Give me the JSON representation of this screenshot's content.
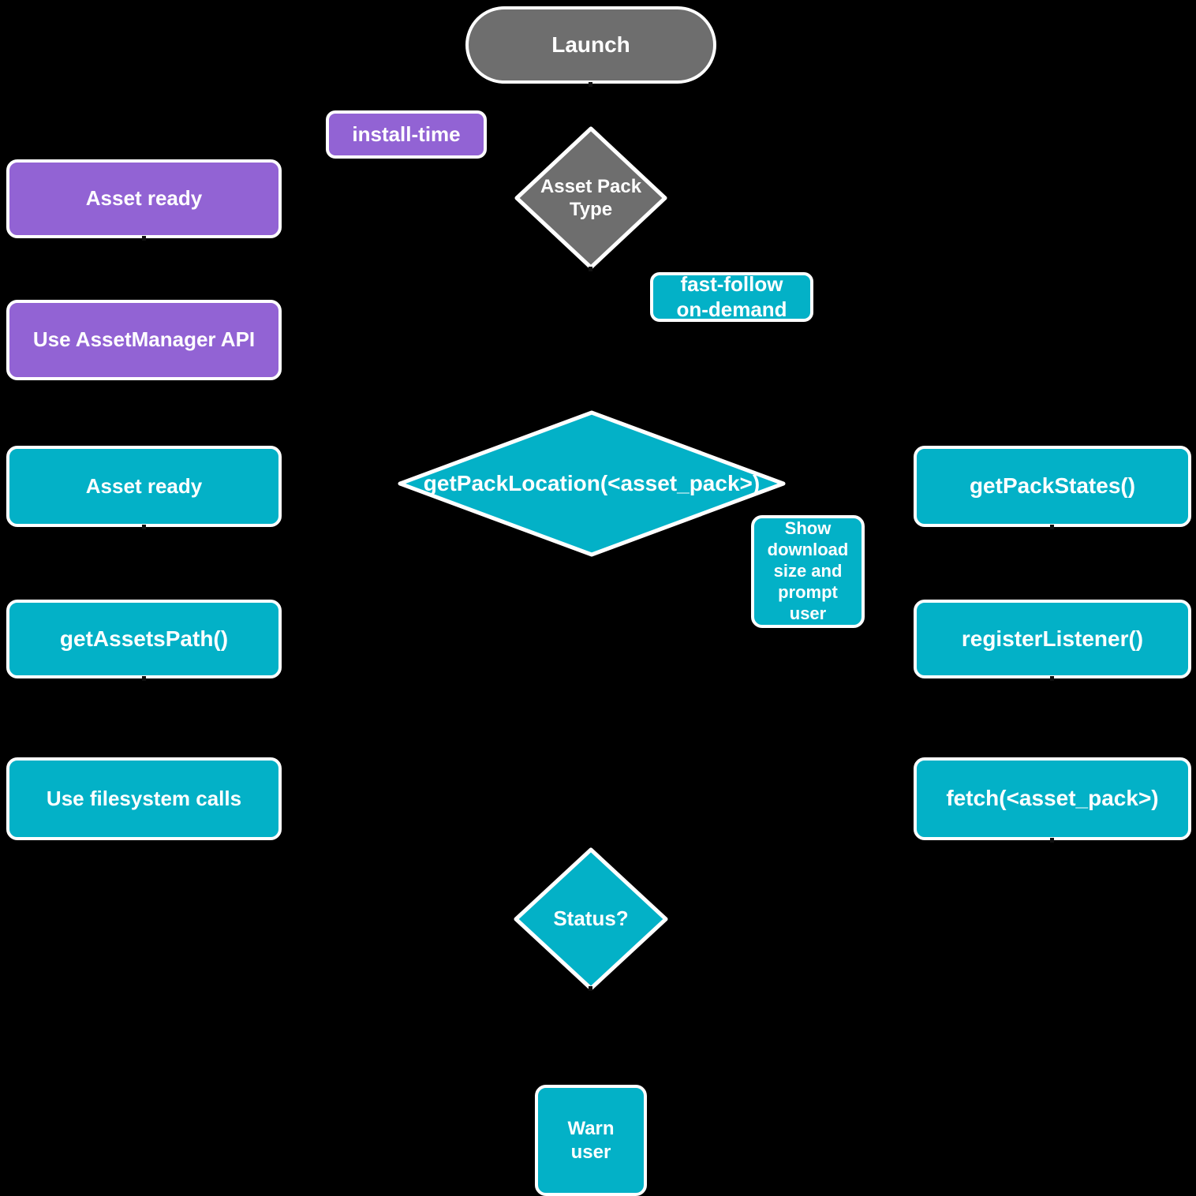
{
  "diagram": {
    "title": "Android App Bundle asset pack delivery flow",
    "background_color": "#000000",
    "colors": {
      "gray": "#6e6e6e",
      "purple": "#9263d4",
      "cyan": "#03b1c7",
      "text": "#ffffff",
      "border": "#ffffff"
    },
    "nodes": {
      "launch": {
        "label": "Launch",
        "shape": "pill",
        "color": "gray"
      },
      "install_time_label": {
        "label": "install-time",
        "shape": "chip",
        "color": "purple"
      },
      "asset_pack_type": {
        "label": "Asset Pack\nType",
        "shape": "diamond",
        "color": "gray"
      },
      "asset_ready_purple": {
        "label": "Asset ready",
        "shape": "rect",
        "color": "purple"
      },
      "fast_follow_label": {
        "label": "fast-follow\non-demand",
        "shape": "chip",
        "color": "cyan"
      },
      "use_assetmanager_api": {
        "label": "Use AssetManager API",
        "shape": "rect",
        "color": "purple"
      },
      "asset_ready_cyan": {
        "label": "Asset ready",
        "shape": "rect",
        "color": "cyan"
      },
      "get_pack_location": {
        "label": "getPackLocation(<asset_pack>)",
        "shape": "diamond",
        "color": "cyan"
      },
      "get_pack_states": {
        "label": "getPackStates()",
        "shape": "rect",
        "color": "cyan"
      },
      "show_download_prompt": {
        "label": "Show\ndownload\nsize and\nprompt\nuser",
        "shape": "rect",
        "color": "cyan"
      },
      "get_assets_path": {
        "label": "getAssetsPath()",
        "shape": "rect",
        "color": "cyan"
      },
      "register_listener": {
        "label": "registerListener()",
        "shape": "rect",
        "color": "cyan"
      },
      "use_filesystem_calls": {
        "label": "Use filesystem calls",
        "shape": "rect",
        "color": "cyan"
      },
      "fetch_asset_pack": {
        "label": "fetch(<asset_pack>)",
        "shape": "rect",
        "color": "cyan"
      },
      "status_decision": {
        "label": "Status?",
        "shape": "diamond",
        "color": "cyan"
      },
      "warn_user": {
        "label": "Warn\nuser",
        "shape": "rect",
        "color": "cyan"
      }
    }
  }
}
